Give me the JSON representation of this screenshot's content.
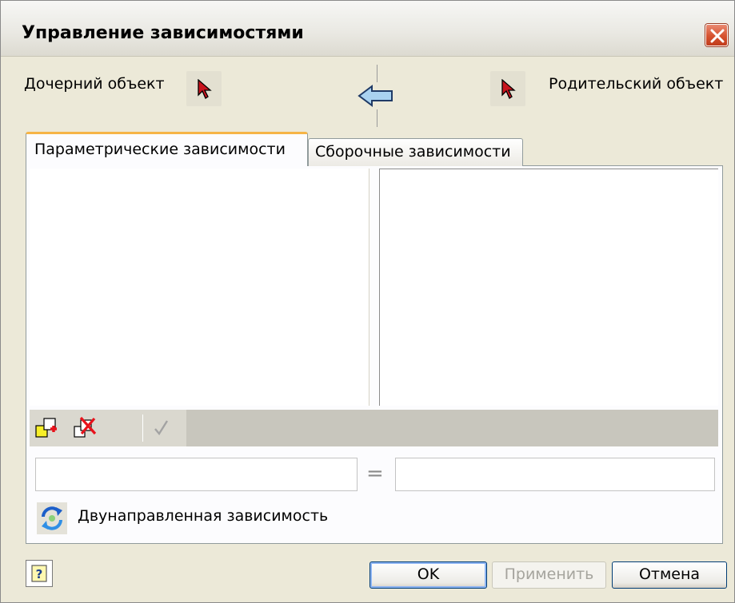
{
  "window": {
    "title": "Управление зависимостями",
    "close_icon": "close-icon"
  },
  "header": {
    "child_label": "Дочерний объект",
    "parent_label": "Родительский объект",
    "pick_icon": "cursor-pick-icon",
    "direction_icon": "arrow-left-icon"
  },
  "tabs": [
    {
      "label": "Параметрические зависимости",
      "active": true
    },
    {
      "label": "Сборочные зависимости",
      "active": false
    }
  ],
  "toolbar": {
    "add_icon": "add-dependency-icon",
    "delete_icon": "delete-dependency-icon",
    "apply_icon": "checkmark-icon"
  },
  "expression": {
    "left_value": "",
    "right_value": "",
    "operator": "="
  },
  "bidirectional": {
    "label": "Двунаправленная зависимость",
    "icon": "bidirectional-refresh-icon"
  },
  "footer": {
    "help_icon": "help-icon",
    "ok_label": "OK",
    "apply_label": "Применить",
    "cancel_label": "Отмена"
  },
  "colors": {
    "dialog_bg": "#ece9d8",
    "active_tab_accent": "#f6b446",
    "close_button": "#d6522f",
    "default_button_border": "#003c74"
  }
}
